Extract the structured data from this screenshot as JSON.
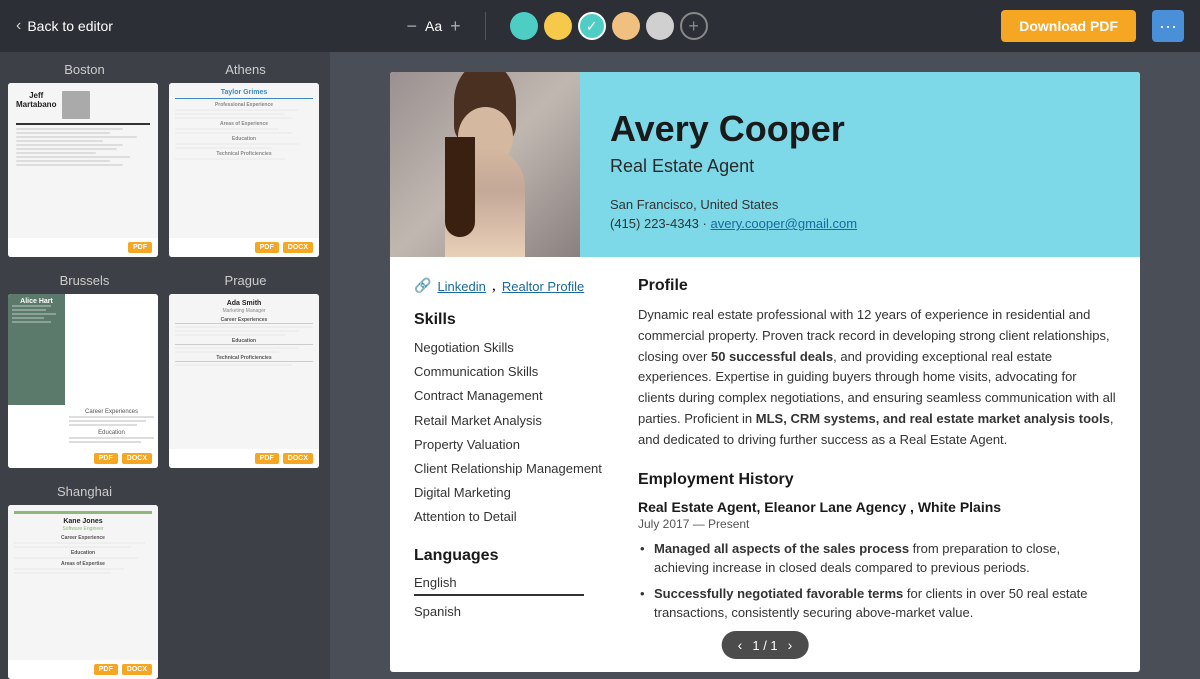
{
  "topbar": {
    "back_label": "Back to editor",
    "font_size": "Aa",
    "download_label": "Download PDF",
    "more_icon": "···"
  },
  "left_panel": {
    "templates": [
      {
        "name": "Boston",
        "badges": [
          "PDF"
        ]
      },
      {
        "name": "Athens",
        "badges": [
          "PDF",
          "DOCX"
        ]
      },
      {
        "name": "Brussels",
        "badges": [
          "PDF",
          "DOCX"
        ]
      },
      {
        "name": "Prague",
        "badges": [
          "PDF",
          "DOCX"
        ]
      },
      {
        "name": "Shanghai",
        "badges": [
          "PDF",
          "DOCX"
        ]
      }
    ]
  },
  "resume": {
    "name": "Avery Cooper",
    "title": "Real Estate Agent",
    "location": "San Francisco, United States",
    "phone": "(415) 223-4343",
    "email": "avery.cooper@gmail.com",
    "links": [
      "Linkedin",
      "Realtor Profile"
    ],
    "skills_title": "Skills",
    "skills": [
      "Negotiation Skills",
      "Communication Skills",
      "Contract Management",
      "Retail Market Analysis",
      "Property Valuation",
      "Client Relationship Management",
      "Digital Marketing",
      "Attention to Detail"
    ],
    "languages_title": "Languages",
    "languages": [
      "English",
      "Spanish"
    ],
    "profile_title": "Profile",
    "profile_text_1": "Dynamic real estate professional with 12 years of experience in residential and commercial property. Proven track record in developing strong client relationships, closing over ",
    "profile_bold_1": "50 successful deals",
    "profile_text_2": ", and providing exceptional real estate experiences. Expertise in guiding buyers through home visits, advocating for clients during complex negotiations, and ensuring seamless communication with all parties. Proficient in ",
    "profile_bold_2": "MLS, CRM systems, and real estate market analysis tools",
    "profile_text_3": ", and dedicated to driving further success as a Real Estate Agent.",
    "employment_title": "Employment History",
    "jobs": [
      {
        "title": "Real Estate Agent, Eleanor Lane Agency , White Plains",
        "date": "July 2017 — Present",
        "bullets": [
          {
            "text_1": "Managed all aspects of the sales process",
            "bold": true,
            "text_2": " from preparation to close, achieving increase in closed deals compared to previous periods."
          },
          {
            "text_1": "Successfully negotiated favorable terms",
            "bold": true,
            "text_2": " for clients in over 50 real estate transactions, consistently securing above-market value."
          }
        ]
      }
    ],
    "page_counter": "1 / 1"
  }
}
